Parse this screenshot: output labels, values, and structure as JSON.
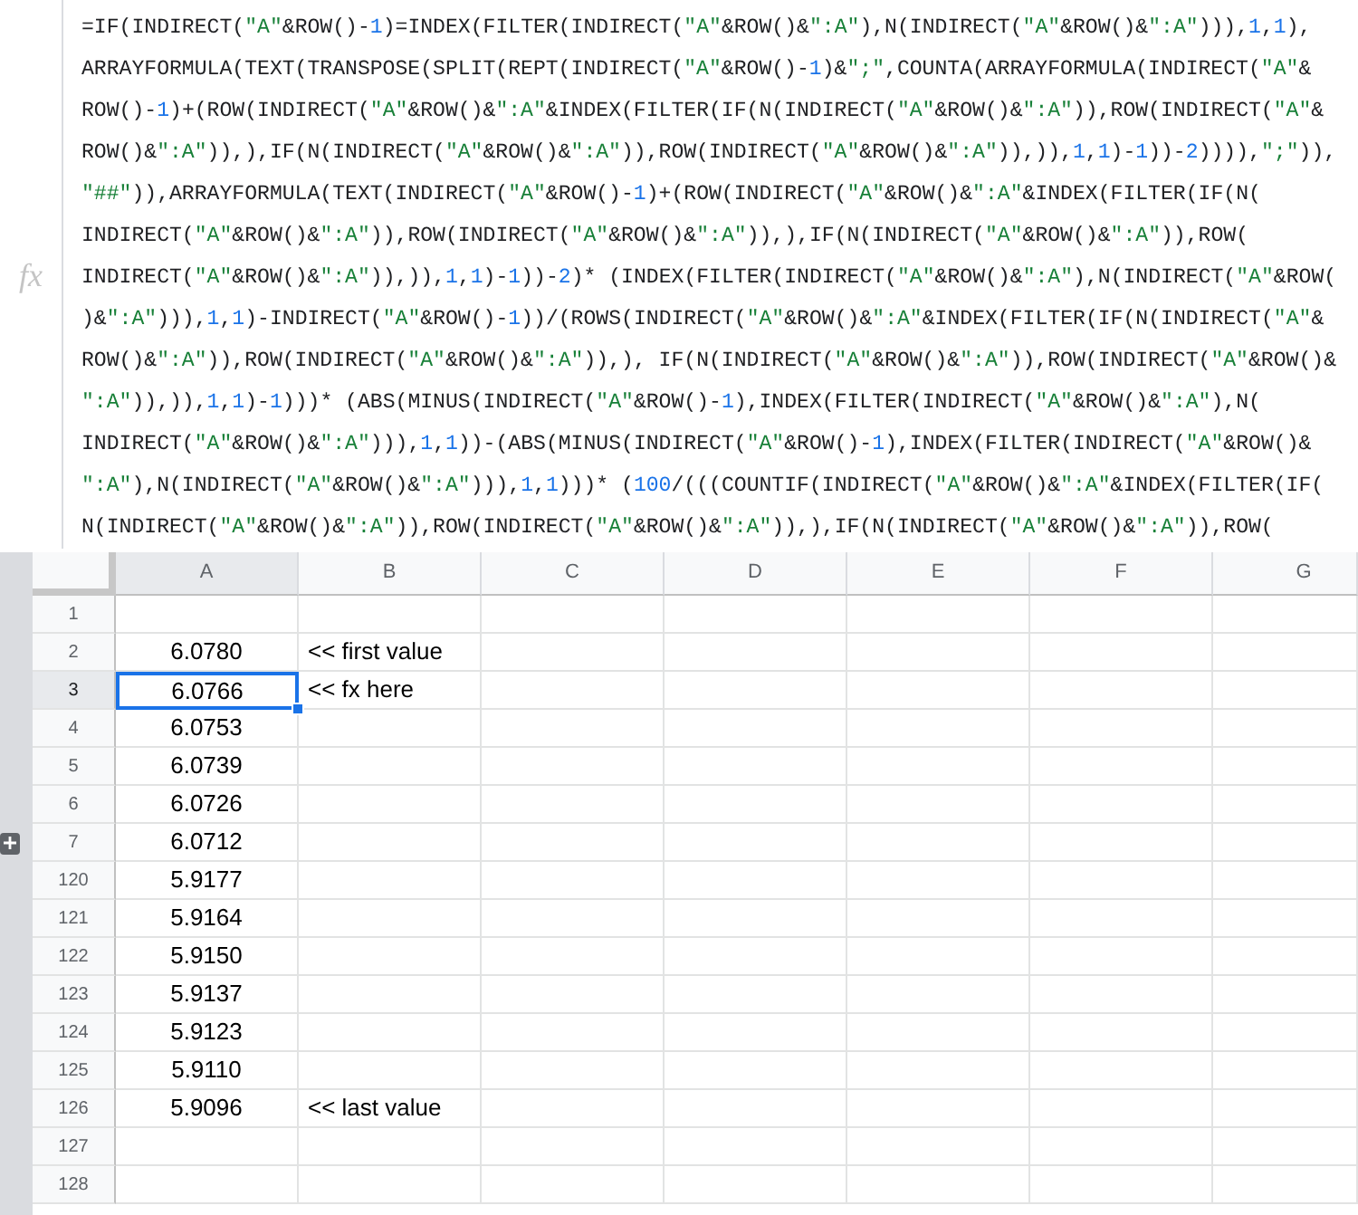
{
  "formula_bar": {
    "label": "fx",
    "lines": [
      "=IF(INDIRECT(\"A\"&ROW()-1)=INDEX(FILTER(INDIRECT(\"A\"&ROW()&\":A\"),N(INDIRECT(\"A\"&ROW()&\":A\"))),1,1),",
      "ARRAYFORMULA(TEXT(TRANSPOSE(SPLIT(REPT(INDIRECT(\"A\"&ROW()-1)&\";\",COUNTA(ARRAYFORMULA(INDIRECT(\"A\"&",
      "ROW()-1)+(ROW(INDIRECT(\"A\"&ROW()&\":A\"&INDEX(FILTER(IF(N(INDIRECT(\"A\"&ROW()&\":A\")),ROW(INDIRECT(\"A\"&",
      "ROW()&\":A\")),),IF(N(INDIRECT(\"A\"&ROW()&\":A\")),ROW(INDIRECT(\"A\"&ROW()&\":A\")),)),1,1)-1))-2)))),\";\")),",
      "\"##\")),ARRAYFORMULA(TEXT(INDIRECT(\"A\"&ROW()-1)+(ROW(INDIRECT(\"A\"&ROW()&\":A\"&INDEX(FILTER(IF(N(",
      "INDIRECT(\"A\"&ROW()&\":A\")),ROW(INDIRECT(\"A\"&ROW()&\":A\")),),IF(N(INDIRECT(\"A\"&ROW()&\":A\")),ROW(",
      "INDIRECT(\"A\"&ROW()&\":A\")),)),1,1)-1))-2)* (INDEX(FILTER(INDIRECT(\"A\"&ROW()&\":A\"),N(INDIRECT(\"A\"&ROW(",
      ")&\":A\"))),1,1)-INDIRECT(\"A\"&ROW()-1))/(ROWS(INDIRECT(\"A\"&ROW()&\":A\"&INDEX(FILTER(IF(N(INDIRECT(\"A\"&",
      "ROW()&\":A\")),ROW(INDIRECT(\"A\"&ROW()&\":A\")),), IF(N(INDIRECT(\"A\"&ROW()&\":A\")),ROW(INDIRECT(\"A\"&ROW()&",
      "\":A\")),)),1,1)-1)))* (ABS(MINUS(INDIRECT(\"A\"&ROW()-1),INDEX(FILTER(INDIRECT(\"A\"&ROW()&\":A\"),N(",
      "INDIRECT(\"A\"&ROW()&\":A\"))),1,1))-(ABS(MINUS(INDIRECT(\"A\"&ROW()-1),INDEX(FILTER(INDIRECT(\"A\"&ROW()&",
      "\":A\"),N(INDIRECT(\"A\"&ROW()&\":A\"))),1,1)))* (100/(((COUNTIF(INDIRECT(\"A\"&ROW()&\":A\"&INDEX(FILTER(IF(",
      "N(INDIRECT(\"A\"&ROW()&\":A\")),ROW(INDIRECT(\"A\"&ROW()&\":A\")),),IF(N(INDIRECT(\"A\"&ROW()&\":A\")),ROW("
    ]
  },
  "sheet": {
    "columns": [
      {
        "label": "A",
        "selected": true
      },
      {
        "label": "B",
        "selected": false
      },
      {
        "label": "C",
        "selected": false
      },
      {
        "label": "D",
        "selected": false
      },
      {
        "label": "E",
        "selected": false
      },
      {
        "label": "F",
        "selected": false
      },
      {
        "label": "G",
        "selected": false
      }
    ],
    "rows": [
      {
        "number": "1",
        "selected": false,
        "collapsed_group": false
      },
      {
        "number": "2",
        "selected": false,
        "collapsed_group": false,
        "a": "6.0780",
        "b": "<< first value"
      },
      {
        "number": "3",
        "selected": true,
        "collapsed_group": false,
        "a": "6.0766",
        "b": "<< fx here"
      },
      {
        "number": "4",
        "selected": false,
        "collapsed_group": false,
        "a": "6.0753"
      },
      {
        "number": "5",
        "selected": false,
        "collapsed_group": false,
        "a": "6.0739"
      },
      {
        "number": "6",
        "selected": false,
        "collapsed_group": false,
        "a": "6.0726"
      },
      {
        "number": "7",
        "selected": false,
        "collapsed_group": true,
        "a": "6.0712"
      },
      {
        "number": "120",
        "selected": false,
        "collapsed_group": false,
        "a": "5.9177"
      },
      {
        "number": "121",
        "selected": false,
        "collapsed_group": false,
        "a": "5.9164"
      },
      {
        "number": "122",
        "selected": false,
        "collapsed_group": false,
        "a": "5.9150"
      },
      {
        "number": "123",
        "selected": false,
        "collapsed_group": false,
        "a": "5.9137"
      },
      {
        "number": "124",
        "selected": false,
        "collapsed_group": false,
        "a": "5.9123"
      },
      {
        "number": "125",
        "selected": false,
        "collapsed_group": false,
        "a": "5.9110"
      },
      {
        "number": "126",
        "selected": false,
        "collapsed_group": false,
        "a": "5.9096",
        "b": "<< last value"
      },
      {
        "number": "127",
        "selected": false,
        "collapsed_group": false
      },
      {
        "number": "128",
        "selected": false,
        "collapsed_group": false
      }
    ]
  }
}
